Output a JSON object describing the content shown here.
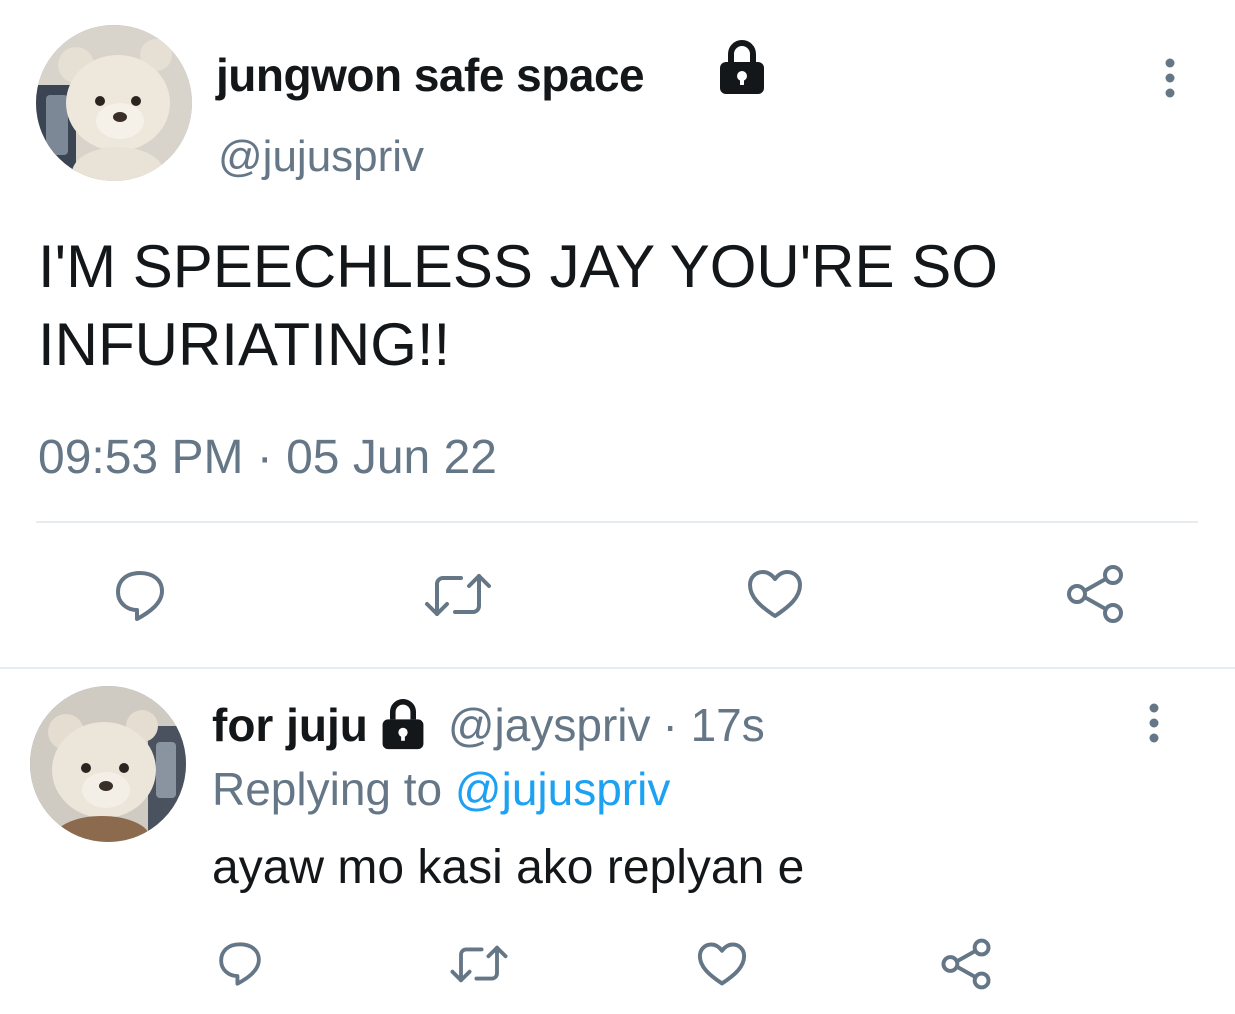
{
  "main_tweet": {
    "display_name": "jungwon safe space",
    "handle": "@jujuspriv",
    "text": "I'M SPEECHLESS JAY YOU'RE SO INFURIATING!!",
    "timestamp": "09:53 PM · 05 Jun 22",
    "icons": {
      "lock": "lock-icon",
      "more": "more-vertical-icon",
      "reply": "reply-icon",
      "retweet": "retweet-icon",
      "like": "like-icon",
      "share": "share-icon"
    }
  },
  "reply_tweet": {
    "display_name": "for juju",
    "handle": "@jayspriv",
    "time_ago": "· 17s",
    "replying_prefix": "Replying to",
    "replying_mention": "@jujuspriv",
    "text": "ayaw mo kasi ako replyan e"
  },
  "colors": {
    "text_primary": "#14171a",
    "text_secondary": "#657786",
    "link": "#1da1f2",
    "divider": "#e6ecf0",
    "icon": "#657786"
  }
}
